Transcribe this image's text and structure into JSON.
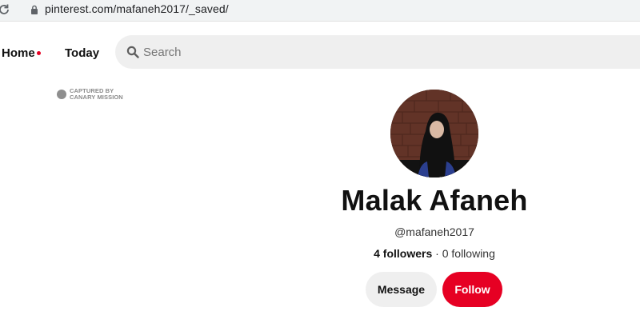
{
  "browser": {
    "url": "pinterest.com/mafaneh2017/_saved/"
  },
  "nav": {
    "home_label": "Home",
    "today_label": "Today",
    "accent_color": "#e60023"
  },
  "search": {
    "placeholder": "Search"
  },
  "watermark": {
    "line1": "CAPTURED BY",
    "line2": "CANARY MISSION"
  },
  "profile": {
    "name": "Malak Afaneh",
    "username": "@mafaneh2017",
    "followers_count": "4 followers",
    "separator": " · ",
    "following_count": "0 following"
  },
  "actions": {
    "message_label": "Message",
    "follow_label": "Follow"
  }
}
